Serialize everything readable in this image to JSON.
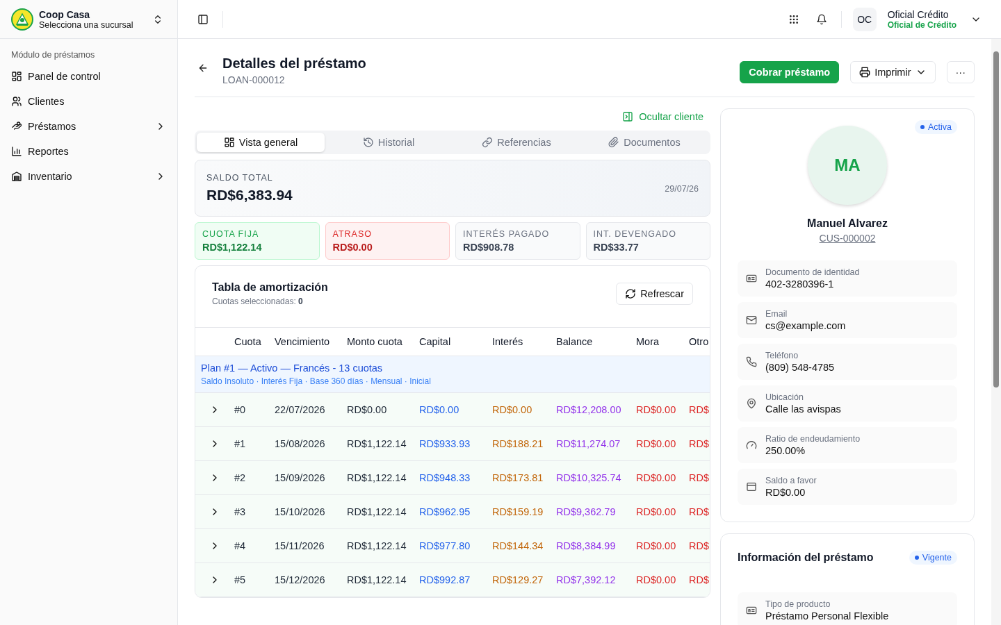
{
  "sidebar": {
    "org_name": "Coop Casa",
    "org_subtitle": "Selecciona una sucursal",
    "section": "Módulo de préstamos",
    "items": [
      {
        "label": "Panel de control",
        "kind": "grid",
        "has_children": false
      },
      {
        "label": "Clientes",
        "kind": "users",
        "has_children": false
      },
      {
        "label": "Préstamos",
        "kind": "hand",
        "has_children": true
      },
      {
        "label": "Reportes",
        "kind": "chart",
        "has_children": false
      },
      {
        "label": "Inventario",
        "kind": "warehouse",
        "has_children": true
      }
    ]
  },
  "topbar": {
    "user_initials": "OC",
    "user_name": "Oficial Crédito",
    "user_role": "Oficial de Crédito"
  },
  "page": {
    "title": "Detalles del préstamo",
    "loan_id": "LOAN-000012",
    "primary_action": "Cobrar préstamo",
    "print_action": "Imprimir",
    "more_action": "···"
  },
  "toggle_client": "Ocultar cliente",
  "tabs": [
    {
      "label": "Vista general",
      "kind": "grid",
      "selected": true
    },
    {
      "label": "Historial",
      "kind": "history",
      "selected": false
    },
    {
      "label": "Referencias",
      "kind": "link",
      "selected": false
    },
    {
      "label": "Documentos",
      "kind": "clip",
      "selected": false
    }
  ],
  "balance": {
    "label": "SALDO TOTAL",
    "amount": "RD$6,383.94",
    "date": "29/07/26"
  },
  "stats": [
    {
      "label": "CUOTA FIJA",
      "value": "RD$1,122.14",
      "kind": "success"
    },
    {
      "label": "ATRASO",
      "value": "RD$0.00",
      "kind": "danger"
    },
    {
      "label": "INTERÉS PAGADO",
      "value": "RD$908.78",
      "kind": "neutral"
    },
    {
      "label": "INT. DEVENGADO",
      "value": "RD$33.77",
      "kind": "neutral"
    }
  ],
  "amortization": {
    "title": "Tabla de amortización",
    "selected_label": "Cuotas seleccionadas:",
    "selected_count": "0",
    "refresh": "Refrescar",
    "columns": [
      {
        "label": "Cuota",
        "kind": "plain"
      },
      {
        "label": "Vencimiento",
        "kind": "plain"
      },
      {
        "label": "Monto cuota",
        "kind": "plain"
      },
      {
        "label": "Capital",
        "kind": "capital"
      },
      {
        "label": "Interés",
        "kind": "interest"
      },
      {
        "label": "Balance",
        "kind": "balance"
      },
      {
        "label": "Mora",
        "kind": "charge"
      },
      {
        "label": "Otro",
        "kind": "charge"
      }
    ],
    "plan_title": "Plan #1 — Activo — Francés - 13 cuotas",
    "plan_details": "Saldo Insoluto · Interés Fija · Base 360 días · Mensual · Inicial",
    "rows": [
      {
        "expanded": false,
        "cells": [
          "#0",
          "22/07/2026",
          "RD$0.00",
          "RD$0.00",
          "RD$0.00",
          "RD$12,208.00",
          "RD$0.00",
          "RD$"
        ]
      },
      {
        "expanded": false,
        "cells": [
          "#1",
          "15/08/2026",
          "RD$1,122.14",
          "RD$933.93",
          "RD$188.21",
          "RD$11,274.07",
          "RD$0.00",
          "RD$"
        ]
      },
      {
        "expanded": false,
        "cells": [
          "#2",
          "15/09/2026",
          "RD$1,122.14",
          "RD$948.33",
          "RD$173.81",
          "RD$10,325.74",
          "RD$0.00",
          "RD$"
        ]
      },
      {
        "expanded": false,
        "cells": [
          "#3",
          "15/10/2026",
          "RD$1,122.14",
          "RD$962.95",
          "RD$159.19",
          "RD$9,362.79",
          "RD$0.00",
          "RD$"
        ]
      },
      {
        "expanded": false,
        "cells": [
          "#4",
          "15/11/2026",
          "RD$1,122.14",
          "RD$977.80",
          "RD$144.34",
          "RD$8,384.99",
          "RD$0.00",
          "RD$"
        ]
      },
      {
        "expanded": false,
        "cells": [
          "#5",
          "15/12/2026",
          "RD$1,122.14",
          "RD$992.87",
          "RD$129.27",
          "RD$7,392.12",
          "RD$0.00",
          "RD$"
        ]
      }
    ]
  },
  "client": {
    "status": "Activa",
    "initials": "MA",
    "name": "Manuel Alvarez",
    "code": "CUS-000002",
    "fields": [
      {
        "label": "Documento de identidad",
        "value": "402-3280396-1",
        "kind": "id"
      },
      {
        "label": "Email",
        "value": "cs@example.com",
        "kind": "mail"
      },
      {
        "label": "Teléfono",
        "value": "(809) 548-4785",
        "kind": "phone"
      },
      {
        "label": "Ubicación",
        "value": "Calle las avispas",
        "kind": "pin"
      },
      {
        "label": "Ratio de endeudamiento",
        "value": "250.00%",
        "kind": "gauge"
      },
      {
        "label": "Saldo a favor",
        "value": "RD$0.00",
        "kind": "wallet"
      }
    ]
  },
  "loan_info": {
    "title": "Información del préstamo",
    "status": "Vigente",
    "fields": [
      {
        "label": "Tipo de producto",
        "value": "Préstamo Personal Flexible",
        "kind": "id"
      }
    ]
  }
}
